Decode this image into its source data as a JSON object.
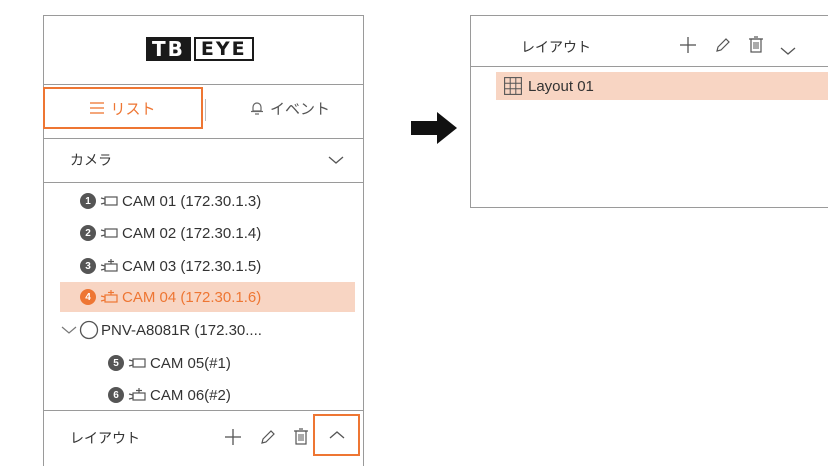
{
  "logo": {
    "left": "TB",
    "right": "EYE"
  },
  "tabs": {
    "list_label": "リスト",
    "event_label": "イベント"
  },
  "camera_section": {
    "label": "カメラ"
  },
  "cameras": [
    {
      "num": "1",
      "label": "CAM 01 (172.30.1.3)",
      "type": "box"
    },
    {
      "num": "2",
      "label": "CAM 02 (172.30.1.4)",
      "type": "box"
    },
    {
      "num": "3",
      "label": "CAM 03 (172.30.1.5)",
      "type": "ptz"
    },
    {
      "num": "4",
      "label": "CAM 04 (172.30.1.6)",
      "type": "ptz"
    }
  ],
  "nvr_group": {
    "label": "PNV-A8081R (172.30...."
  },
  "sub_cameras": [
    {
      "num": "5",
      "label": "CAM 05(#1)",
      "type": "box"
    },
    {
      "num": "6",
      "label": "CAM 06(#2)",
      "type": "ptz"
    }
  ],
  "layout_section": {
    "label": "レイアウト"
  },
  "layout_panel": {
    "label": "レイアウト",
    "items": [
      {
        "label": "Layout 01"
      }
    ]
  },
  "colors": {
    "accent": "#ee7633",
    "selected_bg": "#f8d5c3",
    "border": "#9a9a9a"
  },
  "icons": [
    "list-icon",
    "bell-icon",
    "chevron-down-icon",
    "box-camera-icon",
    "ptz-camera-icon",
    "add-icon",
    "edit-icon",
    "delete-icon",
    "chevron-up-icon",
    "grid-layout-icon",
    "arrow-right-icon"
  ]
}
